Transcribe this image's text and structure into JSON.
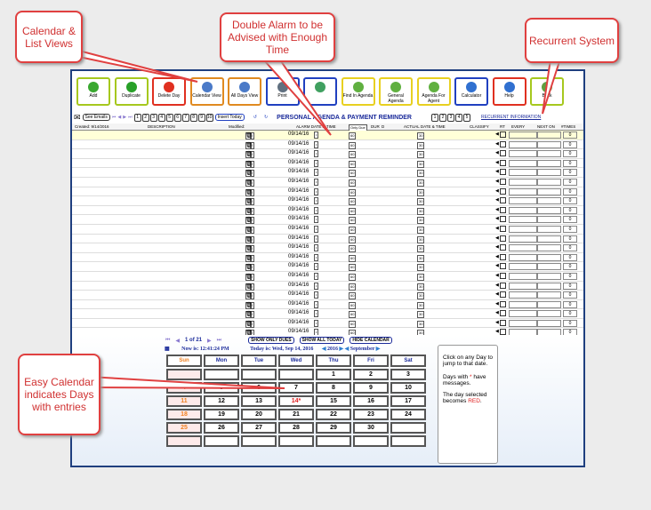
{
  "toolbar": [
    {
      "label": "Add",
      "color": "#a6c81e",
      "icon": "plus-icon",
      "ic": "#3aa830"
    },
    {
      "label": "Duplicate",
      "color": "#a6c81e",
      "icon": "globe-icon",
      "ic": "#28a028"
    },
    {
      "label": "Delete Day",
      "color": "#e03020",
      "icon": "trash-icon",
      "ic": "#e03020"
    },
    {
      "label": "Calendar View",
      "color": "#e08a20",
      "icon": "calendar-icon",
      "ic": "#4a7ac8"
    },
    {
      "label": "All Days View",
      "color": "#e08a20",
      "icon": "calendar-icon",
      "ic": "#4a7ac8"
    },
    {
      "label": "Print",
      "color": "#2040c0",
      "icon": "printer-icon",
      "ic": "#607080"
    },
    {
      "label": "",
      "color": "#2040c0",
      "icon": "book-icon",
      "ic": "#40a060"
    },
    {
      "label": "Find In Agenda",
      "color": "#e8d020",
      "icon": "magnifier-icon",
      "ic": "#60b040"
    },
    {
      "label": "General Agenda",
      "color": "#e8d020",
      "icon": "magnifier-icon",
      "ic": "#60b040"
    },
    {
      "label": "Agenda For Agent",
      "color": "#e8d020",
      "icon": "magnifier-icon",
      "ic": "#60b040"
    },
    {
      "label": "Calculator",
      "color": "#2040c0",
      "icon": "calculator-icon",
      "ic": "#3070d0"
    },
    {
      "label": "Help",
      "color": "#e03020",
      "icon": "info-icon",
      "ic": "#3070d0"
    },
    {
      "label": "Back",
      "color": "#a6c81e",
      "icon": "back-arrow-icon",
      "ic": "#60a040"
    }
  ],
  "nav": {
    "see_emails": "See Emails",
    "pages": [
      "1",
      "2",
      "3",
      "4",
      "5",
      "6",
      "7",
      "8",
      "9",
      "10"
    ],
    "insert_today": "Insert Today",
    "title": "PERSONAL AGENDA & PAYMENT REMINDER",
    "right_pages": [
      "1",
      "2",
      "3",
      "4",
      "5"
    ],
    "recurrent": "RECURRENT INFORMATION"
  },
  "header": {
    "created": "Created: 9/14/2016",
    "description": "DESCRIPTION",
    "modified": "Modified:",
    "alarm": "ALARM DATE & TIME",
    "only_due": "Only Due",
    "dur": "DUR",
    "d": "D",
    "actual": "ACTUAL DATE & TIME",
    "classify": "CLASSIFY",
    "rt": "RT",
    "every": "EVERY",
    "next_on": "NEXT ON",
    "times": "#TIMES"
  },
  "row_date": "09/14/16",
  "row_times": "0",
  "row_count": 24,
  "calendar": {
    "page": "1 of 21",
    "show_only_dues": "SHOW ONLY DUES",
    "show_all_today": "SHOW ALL TODAY",
    "hide_calendar": "HIDE CALENDAR",
    "now": "Now is: 12:41:24 PM",
    "today": "Today is: Wed, Sep 14, 2016",
    "year": "2016",
    "month": "September",
    "days": [
      "Sun",
      "Mon",
      "Tue",
      "Wed",
      "Thu",
      "Fri",
      "Sat"
    ],
    "weeks": [
      [
        "",
        "",
        "",
        "",
        "1",
        "2",
        "3"
      ],
      [
        "4",
        "5",
        "6",
        "7",
        "8",
        "9",
        "10"
      ],
      [
        "11",
        "12",
        "13",
        "14*",
        "15",
        "16",
        "17"
      ],
      [
        "18",
        "19",
        "20",
        "21",
        "22",
        "23",
        "24"
      ],
      [
        "25",
        "26",
        "27",
        "28",
        "29",
        "30",
        ""
      ],
      [
        "",
        "",
        "",
        "",
        "",
        "",
        ""
      ]
    ],
    "selected": "14*"
  },
  "info": {
    "p1": "Click on any Day to jump to that date.",
    "p2a": "Days with",
    "star": "*",
    "p2b": "have messages.",
    "p3a": "The day selected becomes",
    "red": "RED",
    "p3b": "."
  },
  "callouts": {
    "views": "Calendar & List Views",
    "alarm": "Double Alarm to be Advised with Enough Time",
    "recurrent": "Recurrent System",
    "calendar": "Easy Calendar indicates Days with entries"
  }
}
